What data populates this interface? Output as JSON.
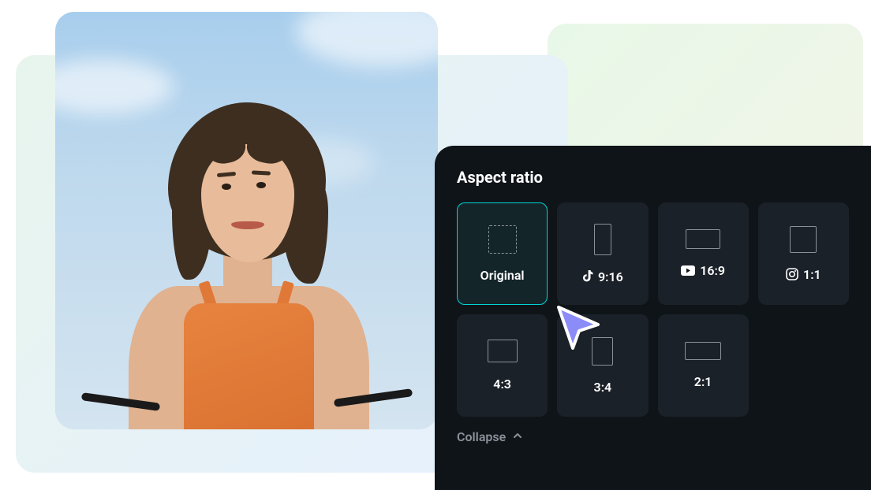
{
  "panel": {
    "title": "Aspect ratio",
    "collapse_label": "Collapse"
  },
  "ratios": [
    {
      "id": "original",
      "label": "Original",
      "selected": true,
      "iconName": null,
      "previewClass": "rect-original",
      "dashed": true
    },
    {
      "id": "9-16",
      "label": "9:16",
      "selected": false,
      "iconName": "tiktok-icon",
      "previewClass": "rect-9-16",
      "dashed": false
    },
    {
      "id": "16-9",
      "label": "16:9",
      "selected": false,
      "iconName": "youtube-icon",
      "previewClass": "rect-16-9",
      "dashed": false
    },
    {
      "id": "1-1",
      "label": "1:1",
      "selected": false,
      "iconName": "instagram-icon",
      "previewClass": "rect-1-1",
      "dashed": false
    },
    {
      "id": "4-3",
      "label": "4:3",
      "selected": false,
      "iconName": null,
      "previewClass": "rect-4-3",
      "dashed": false
    },
    {
      "id": "3-4",
      "label": "3:4",
      "selected": false,
      "iconName": null,
      "previewClass": "rect-3-4",
      "dashed": false
    },
    {
      "id": "2-1",
      "label": "2:1",
      "selected": false,
      "iconName": null,
      "previewClass": "rect-2-1",
      "dashed": false
    }
  ],
  "cursor": {
    "color": "#8b8cf7"
  }
}
